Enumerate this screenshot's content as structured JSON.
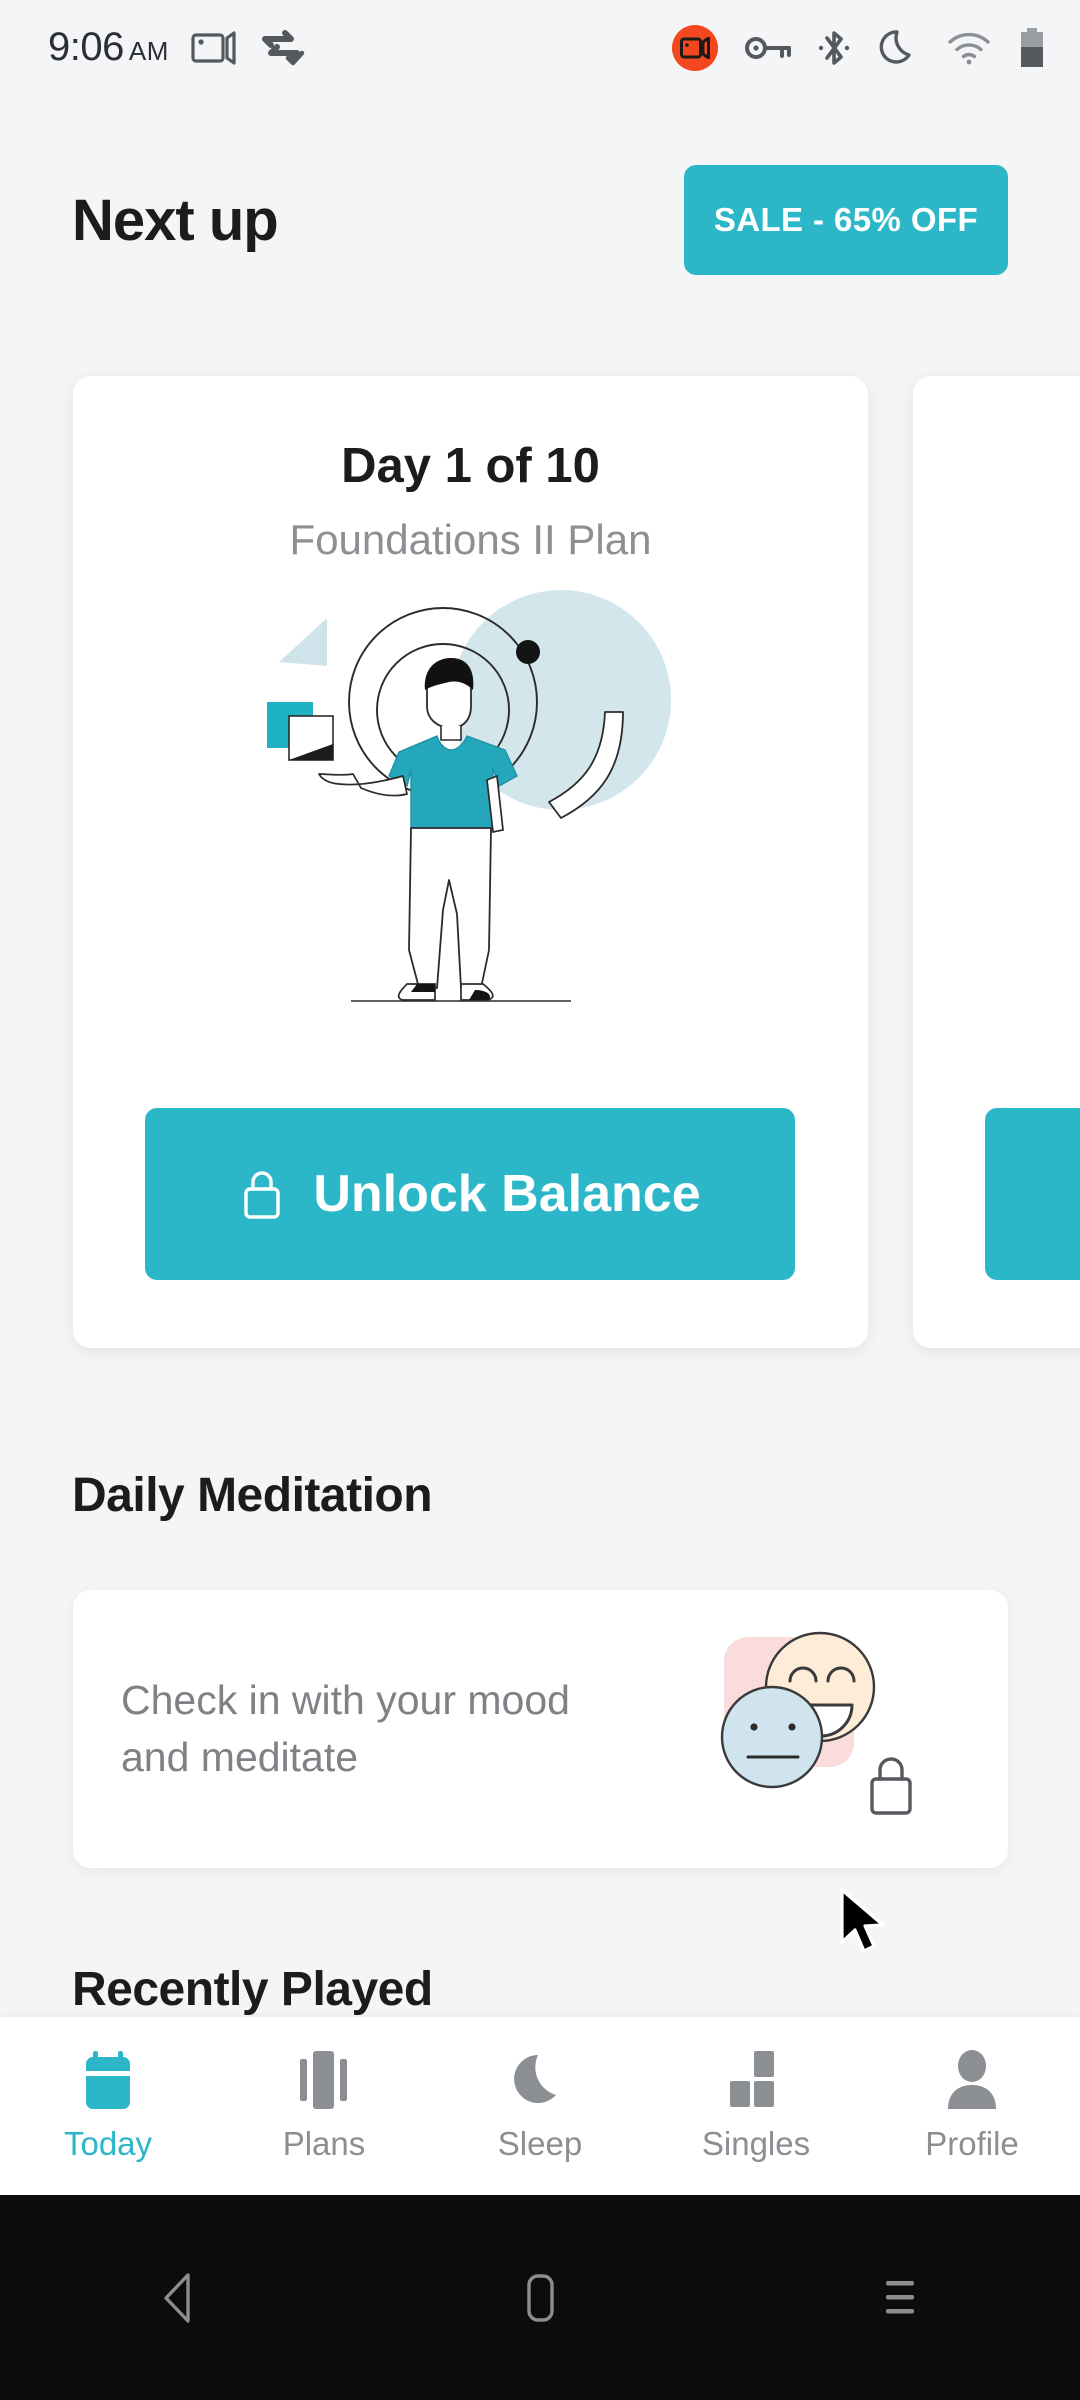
{
  "status_bar": {
    "time": "9:06",
    "meridiem": "AM",
    "icons": [
      {
        "name": "screen-cast-icon"
      },
      {
        "name": "data-saver-check-icon"
      },
      {
        "name": "screen-record-badge-icon"
      },
      {
        "name": "vpn-key-icon"
      },
      {
        "name": "bluetooth-icon"
      },
      {
        "name": "do-not-disturb-moon-icon"
      },
      {
        "name": "wifi-icon"
      },
      {
        "name": "battery-icon"
      }
    ]
  },
  "header": {
    "title": "Next up",
    "sale_label": "SALE - 65% OFF"
  },
  "plan_card": {
    "day_label": "Day 1 of 10",
    "plan_name": "Foundations II Plan",
    "unlock_label": "Unlock Balance",
    "lock_icon": "lock-icon"
  },
  "sections": {
    "daily_meditation": "Daily Meditation",
    "recently_played": "Recently Played"
  },
  "meditation_card": {
    "text": "Check in with your mood and meditate",
    "lock_icon": "lock-icon"
  },
  "tabs": [
    {
      "label": "Today",
      "icon": "calendar-icon",
      "active": true
    },
    {
      "label": "Plans",
      "icon": "bars-icon",
      "active": false
    },
    {
      "label": "Sleep",
      "icon": "moon-icon",
      "active": false
    },
    {
      "label": "Singles",
      "icon": "blocks-icon",
      "active": false
    },
    {
      "label": "Profile",
      "icon": "person-icon",
      "active": false
    }
  ],
  "android_nav": [
    {
      "name": "back-button"
    },
    {
      "name": "home-button"
    },
    {
      "name": "recents-button"
    }
  ],
  "colors": {
    "accent": "#2cb7c9",
    "background": "#f4f5f6",
    "card": "#ffffff",
    "text_primary": "#1c1c1e",
    "text_muted": "#8b8e92",
    "record_red": "#f4471f",
    "face_peach": "#fdecd8",
    "face_blue": "#cfe4ee",
    "pink_block": "#fadcdc"
  }
}
